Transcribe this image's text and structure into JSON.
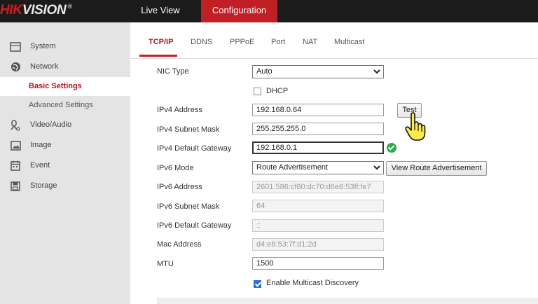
{
  "header": {
    "logo_brand": "HIK",
    "logo_rest": "VISION",
    "logo_mark": "®",
    "tabs": [
      {
        "label": "Live View"
      },
      {
        "label": "Configuration"
      }
    ]
  },
  "sidebar": {
    "items": [
      {
        "label": "System",
        "icon": "monitor-icon"
      },
      {
        "label": "Network",
        "icon": "globe-icon"
      },
      {
        "label": "Basic Settings"
      },
      {
        "label": "Advanced Settings"
      },
      {
        "label": "Video/Audio",
        "icon": "microphone-icon"
      },
      {
        "label": "Image",
        "icon": "image-icon"
      },
      {
        "label": "Event",
        "icon": "calendar-icon"
      },
      {
        "label": "Storage",
        "icon": "save-icon"
      }
    ]
  },
  "subtabs": [
    "TCP/IP",
    "DDNS",
    "PPPoE",
    "Port",
    "NAT",
    "Multicast"
  ],
  "form": {
    "nic_type": {
      "label": "NIC Type",
      "value": "Auto"
    },
    "dhcp": {
      "label": "DHCP",
      "checked": false
    },
    "ipv4_address": {
      "label": "IPv4 Address",
      "value": "192.168.0.64"
    },
    "test_button": "Test",
    "ipv4_subnet": {
      "label": "IPv4 Subnet Mask",
      "value": "255.255.255.0"
    },
    "ipv4_gateway": {
      "label": "IPv4 Default Gateway",
      "value": "192.168.0.1"
    },
    "ipv6_mode": {
      "label": "IPv6 Mode",
      "value": "Route Advertisement"
    },
    "view_route_button": "View Route Advertisement",
    "ipv6_address": {
      "label": "IPv6 Address",
      "value": "2601:586:cf80:dc70:d6e8:53ff:fe7"
    },
    "ipv6_subnet": {
      "label": "IPv6 Subnet Mask",
      "value": "64"
    },
    "ipv6_gateway": {
      "label": "IPv6 Default Gateway",
      "value": "::"
    },
    "mac_address": {
      "label": "Mac Address",
      "value": "d4:e8:53:7f:d1:2d"
    },
    "mtu": {
      "label": "MTU",
      "value": "1500"
    },
    "multicast_discovery": {
      "label": "Enable Multicast Discovery",
      "checked": true
    }
  },
  "colors": {
    "accent": "#c01f25",
    "header_bg": "#1b1b1b",
    "sidebar_bg": "#e4e4e4",
    "ok": "#2fa84f",
    "checkbox": "#2f6fd6"
  }
}
